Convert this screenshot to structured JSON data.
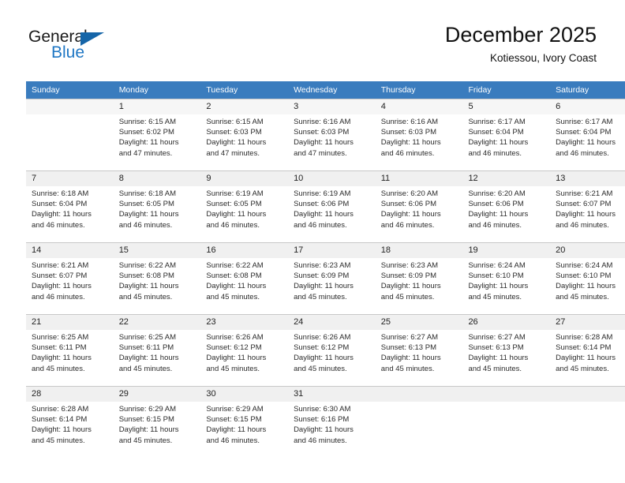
{
  "logo": {
    "line1": "General",
    "line2": "Blue",
    "triangle_color": "#1565a8",
    "blue_text_color": "#1f77c4"
  },
  "header": {
    "title": "December 2025",
    "subtitle": "Kotiessou, Ivory Coast"
  },
  "theme": {
    "header_row_bg": "#3a7cbe",
    "header_row_text": "#ffffff",
    "daynum_bg": "#f0f0f0",
    "grid_line": "#c8c8c8"
  },
  "weekday_headers": [
    "Sunday",
    "Monday",
    "Tuesday",
    "Wednesday",
    "Thursday",
    "Friday",
    "Saturday"
  ],
  "weeks": [
    [
      {
        "day": "",
        "sunrise": "",
        "sunset": "",
        "daylight1": "",
        "daylight2": ""
      },
      {
        "day": "1",
        "sunrise": "Sunrise: 6:15 AM",
        "sunset": "Sunset: 6:02 PM",
        "daylight1": "Daylight: 11 hours",
        "daylight2": "and 47 minutes."
      },
      {
        "day": "2",
        "sunrise": "Sunrise: 6:15 AM",
        "sunset": "Sunset: 6:03 PM",
        "daylight1": "Daylight: 11 hours",
        "daylight2": "and 47 minutes."
      },
      {
        "day": "3",
        "sunrise": "Sunrise: 6:16 AM",
        "sunset": "Sunset: 6:03 PM",
        "daylight1": "Daylight: 11 hours",
        "daylight2": "and 47 minutes."
      },
      {
        "day": "4",
        "sunrise": "Sunrise: 6:16 AM",
        "sunset": "Sunset: 6:03 PM",
        "daylight1": "Daylight: 11 hours",
        "daylight2": "and 46 minutes."
      },
      {
        "day": "5",
        "sunrise": "Sunrise: 6:17 AM",
        "sunset": "Sunset: 6:04 PM",
        "daylight1": "Daylight: 11 hours",
        "daylight2": "and 46 minutes."
      },
      {
        "day": "6",
        "sunrise": "Sunrise: 6:17 AM",
        "sunset": "Sunset: 6:04 PM",
        "daylight1": "Daylight: 11 hours",
        "daylight2": "and 46 minutes."
      }
    ],
    [
      {
        "day": "7",
        "sunrise": "Sunrise: 6:18 AM",
        "sunset": "Sunset: 6:04 PM",
        "daylight1": "Daylight: 11 hours",
        "daylight2": "and 46 minutes."
      },
      {
        "day": "8",
        "sunrise": "Sunrise: 6:18 AM",
        "sunset": "Sunset: 6:05 PM",
        "daylight1": "Daylight: 11 hours",
        "daylight2": "and 46 minutes."
      },
      {
        "day": "9",
        "sunrise": "Sunrise: 6:19 AM",
        "sunset": "Sunset: 6:05 PM",
        "daylight1": "Daylight: 11 hours",
        "daylight2": "and 46 minutes."
      },
      {
        "day": "10",
        "sunrise": "Sunrise: 6:19 AM",
        "sunset": "Sunset: 6:06 PM",
        "daylight1": "Daylight: 11 hours",
        "daylight2": "and 46 minutes."
      },
      {
        "day": "11",
        "sunrise": "Sunrise: 6:20 AM",
        "sunset": "Sunset: 6:06 PM",
        "daylight1": "Daylight: 11 hours",
        "daylight2": "and 46 minutes."
      },
      {
        "day": "12",
        "sunrise": "Sunrise: 6:20 AM",
        "sunset": "Sunset: 6:06 PM",
        "daylight1": "Daylight: 11 hours",
        "daylight2": "and 46 minutes."
      },
      {
        "day": "13",
        "sunrise": "Sunrise: 6:21 AM",
        "sunset": "Sunset: 6:07 PM",
        "daylight1": "Daylight: 11 hours",
        "daylight2": "and 46 minutes."
      }
    ],
    [
      {
        "day": "14",
        "sunrise": "Sunrise: 6:21 AM",
        "sunset": "Sunset: 6:07 PM",
        "daylight1": "Daylight: 11 hours",
        "daylight2": "and 46 minutes."
      },
      {
        "day": "15",
        "sunrise": "Sunrise: 6:22 AM",
        "sunset": "Sunset: 6:08 PM",
        "daylight1": "Daylight: 11 hours",
        "daylight2": "and 45 minutes."
      },
      {
        "day": "16",
        "sunrise": "Sunrise: 6:22 AM",
        "sunset": "Sunset: 6:08 PM",
        "daylight1": "Daylight: 11 hours",
        "daylight2": "and 45 minutes."
      },
      {
        "day": "17",
        "sunrise": "Sunrise: 6:23 AM",
        "sunset": "Sunset: 6:09 PM",
        "daylight1": "Daylight: 11 hours",
        "daylight2": "and 45 minutes."
      },
      {
        "day": "18",
        "sunrise": "Sunrise: 6:23 AM",
        "sunset": "Sunset: 6:09 PM",
        "daylight1": "Daylight: 11 hours",
        "daylight2": "and 45 minutes."
      },
      {
        "day": "19",
        "sunrise": "Sunrise: 6:24 AM",
        "sunset": "Sunset: 6:10 PM",
        "daylight1": "Daylight: 11 hours",
        "daylight2": "and 45 minutes."
      },
      {
        "day": "20",
        "sunrise": "Sunrise: 6:24 AM",
        "sunset": "Sunset: 6:10 PM",
        "daylight1": "Daylight: 11 hours",
        "daylight2": "and 45 minutes."
      }
    ],
    [
      {
        "day": "21",
        "sunrise": "Sunrise: 6:25 AM",
        "sunset": "Sunset: 6:11 PM",
        "daylight1": "Daylight: 11 hours",
        "daylight2": "and 45 minutes."
      },
      {
        "day": "22",
        "sunrise": "Sunrise: 6:25 AM",
        "sunset": "Sunset: 6:11 PM",
        "daylight1": "Daylight: 11 hours",
        "daylight2": "and 45 minutes."
      },
      {
        "day": "23",
        "sunrise": "Sunrise: 6:26 AM",
        "sunset": "Sunset: 6:12 PM",
        "daylight1": "Daylight: 11 hours",
        "daylight2": "and 45 minutes."
      },
      {
        "day": "24",
        "sunrise": "Sunrise: 6:26 AM",
        "sunset": "Sunset: 6:12 PM",
        "daylight1": "Daylight: 11 hours",
        "daylight2": "and 45 minutes."
      },
      {
        "day": "25",
        "sunrise": "Sunrise: 6:27 AM",
        "sunset": "Sunset: 6:13 PM",
        "daylight1": "Daylight: 11 hours",
        "daylight2": "and 45 minutes."
      },
      {
        "day": "26",
        "sunrise": "Sunrise: 6:27 AM",
        "sunset": "Sunset: 6:13 PM",
        "daylight1": "Daylight: 11 hours",
        "daylight2": "and 45 minutes."
      },
      {
        "day": "27",
        "sunrise": "Sunrise: 6:28 AM",
        "sunset": "Sunset: 6:14 PM",
        "daylight1": "Daylight: 11 hours",
        "daylight2": "and 45 minutes."
      }
    ],
    [
      {
        "day": "28",
        "sunrise": "Sunrise: 6:28 AM",
        "sunset": "Sunset: 6:14 PM",
        "daylight1": "Daylight: 11 hours",
        "daylight2": "and 45 minutes."
      },
      {
        "day": "29",
        "sunrise": "Sunrise: 6:29 AM",
        "sunset": "Sunset: 6:15 PM",
        "daylight1": "Daylight: 11 hours",
        "daylight2": "and 45 minutes."
      },
      {
        "day": "30",
        "sunrise": "Sunrise: 6:29 AM",
        "sunset": "Sunset: 6:15 PM",
        "daylight1": "Daylight: 11 hours",
        "daylight2": "and 46 minutes."
      },
      {
        "day": "31",
        "sunrise": "Sunrise: 6:30 AM",
        "sunset": "Sunset: 6:16 PM",
        "daylight1": "Daylight: 11 hours",
        "daylight2": "and 46 minutes."
      },
      {
        "day": "",
        "sunrise": "",
        "sunset": "",
        "daylight1": "",
        "daylight2": ""
      },
      {
        "day": "",
        "sunrise": "",
        "sunset": "",
        "daylight1": "",
        "daylight2": ""
      },
      {
        "day": "",
        "sunrise": "",
        "sunset": "",
        "daylight1": "",
        "daylight2": ""
      }
    ]
  ]
}
